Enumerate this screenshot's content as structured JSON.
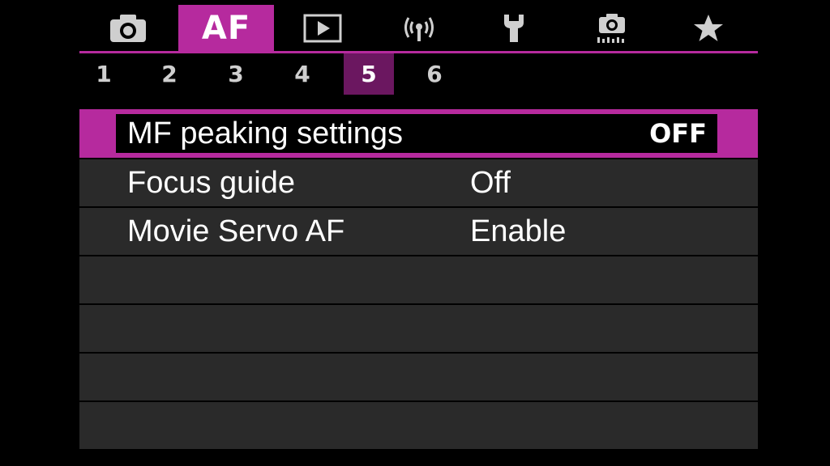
{
  "tabs": [
    {
      "id": "shooting",
      "icon": "camera-icon",
      "active": false
    },
    {
      "id": "af",
      "label": "AF",
      "active": true
    },
    {
      "id": "playback",
      "icon": "play-icon",
      "active": false
    },
    {
      "id": "wireless",
      "icon": "wireless-icon",
      "active": false
    },
    {
      "id": "setup",
      "icon": "wrench-icon",
      "active": false
    },
    {
      "id": "custom",
      "icon": "custom-functions-icon",
      "active": false
    },
    {
      "id": "mymenu",
      "icon": "star-icon",
      "active": false
    }
  ],
  "pages": [
    "1",
    "2",
    "3",
    "4",
    "5",
    "6"
  ],
  "active_page": "5",
  "menu": {
    "items": [
      {
        "label": "MF peaking settings",
        "value": "OFF",
        "selected": true
      },
      {
        "label": "Focus guide",
        "value": "Off",
        "selected": false
      },
      {
        "label": "Movie Servo AF",
        "value": "Enable",
        "selected": false
      }
    ]
  },
  "colors": {
    "accent": "#b62a9e",
    "page_active": "#6b1760",
    "row_bg": "#2a2a2a",
    "background": "#000000"
  }
}
